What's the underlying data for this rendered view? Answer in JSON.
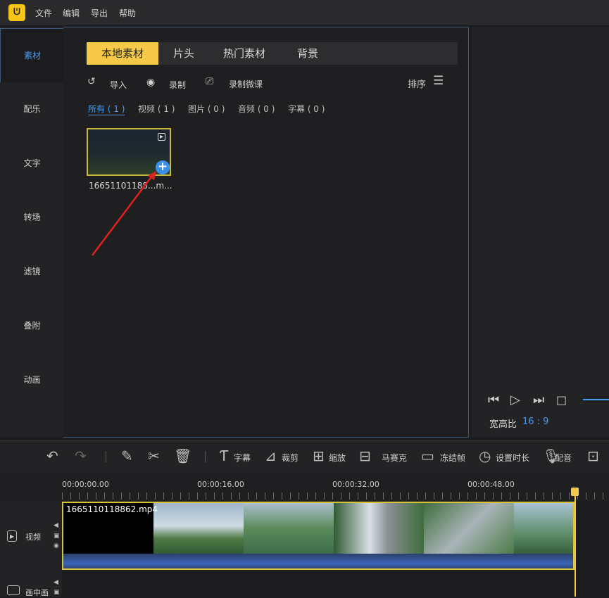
{
  "menu": {
    "items": [
      "文件",
      "编辑",
      "导出",
      "帮助"
    ]
  },
  "nav": {
    "items": [
      "素材",
      "配乐",
      "文字",
      "转场",
      "滤镜",
      "叠附",
      "动画"
    ]
  },
  "tabs": [
    "本地素材",
    "片头",
    "热门素材",
    "背景"
  ],
  "tools": {
    "import": "导入",
    "record": "录制",
    "record_lesson": "录制微课",
    "sort": "排序"
  },
  "filters": [
    "所有 ( 1 )",
    "视频 ( 1 )",
    "图片 ( 0 )",
    "音频 ( 0 )",
    "字幕 ( 0 )"
  ],
  "media": {
    "filename": "16651101188...m..."
  },
  "preview": {
    "ratio_label": "宽高比",
    "ratio_value": "16 : 9"
  },
  "toolbar": {
    "subtitle": "字幕",
    "crop": "裁剪",
    "zoom": "缩放",
    "mosaic": "马赛克",
    "freeze": "冻结帧",
    "duration": "设置时长",
    "dub": "配音"
  },
  "timeline": {
    "times": [
      "00:00:00.00",
      "00:00:16.00",
      "00:00:32.00",
      "00:00:48.00"
    ],
    "video_track": "视频",
    "pip_track": "画中画",
    "clip_name": "1665110118862.mp4"
  },
  "colors": {
    "accent": "#4a9bf0",
    "tab_active": "#f7c948",
    "clip_border": "#d6c33a",
    "playhead": "#f2c94c"
  },
  "icons": [
    "logo-icon",
    "import-icon",
    "record-icon",
    "record-lesson-icon",
    "sort-icon",
    "video-badge-icon",
    "add-icon",
    "prev-frame-icon",
    "play-icon",
    "next-frame-icon",
    "stop-icon",
    "undo-icon",
    "redo-icon",
    "pencil-icon",
    "scissors-icon",
    "trash-icon",
    "subtitle-icon",
    "crop-icon",
    "zoom-icon",
    "mosaic-icon",
    "freeze-icon",
    "clock-icon",
    "mic-icon",
    "video-track-icon",
    "pip-track-icon"
  ]
}
